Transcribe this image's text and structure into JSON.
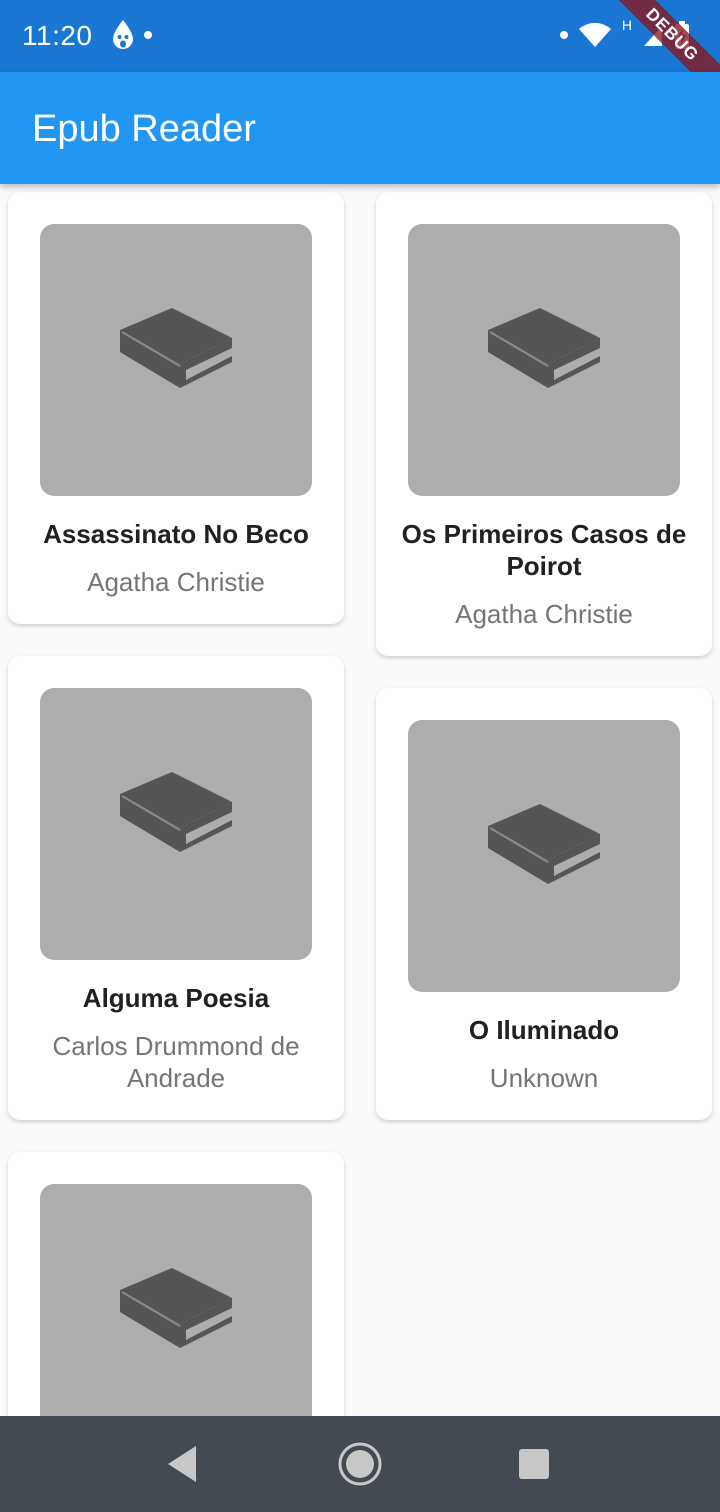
{
  "status_bar": {
    "time": "11:20",
    "icons": [
      "notification-drop-icon",
      "wifi-icon",
      "signal-icon",
      "battery-charging-icon"
    ],
    "network_type": "H"
  },
  "debug_banner": "DEBUG",
  "app_bar": {
    "title": "Epub Reader"
  },
  "books": [
    {
      "title": "Assassinato No Beco",
      "author": "Agatha Christie",
      "icon": "book-icon"
    },
    {
      "title": "Os Primeiros Casos de Poirot",
      "author": "Agatha Christie",
      "icon": "book-icon"
    },
    {
      "title": "Alguma Poesia",
      "author": "Carlos Drummond de Andrade",
      "icon": "book-icon"
    },
    {
      "title": "O Iluminado",
      "author": "Unknown",
      "icon": "book-icon"
    },
    {
      "title": "",
      "author": "",
      "icon": "book-icon"
    }
  ],
  "nav_bar": {
    "buttons": [
      "back-icon",
      "home-icon",
      "recents-icon"
    ]
  },
  "colors": {
    "status_bar": "#1976d2",
    "app_bar": "#2196f3",
    "cover_placeholder": "#adadad",
    "book_icon": "#555555",
    "nav_bar": "#444a52"
  }
}
